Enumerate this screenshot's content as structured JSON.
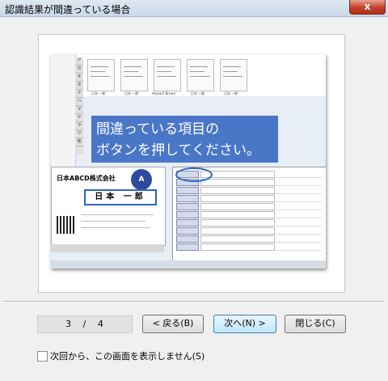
{
  "window": {
    "title": "認識結果が間違っている場合",
    "close_label": "x"
  },
  "illustration": {
    "callout_line1": "間違っている項目の",
    "callout_line2": "ボタンを押してください。",
    "card_company": "日本ABCD株式会社",
    "card_name": "日本 一郎",
    "thumbnails": [
      "日本 一郎",
      "日本 一郎",
      "Howard Brown",
      "日本 一郎",
      "日本 一郎"
    ]
  },
  "pager": {
    "current": "3",
    "separator": "/",
    "total": "4"
  },
  "buttons": {
    "back": "< 戻る(B)",
    "next": "次へ(N) >",
    "close": "閉じる(C)"
  },
  "checkbox": {
    "label": "次回から、この画面を表示しません(S)",
    "checked": false
  }
}
